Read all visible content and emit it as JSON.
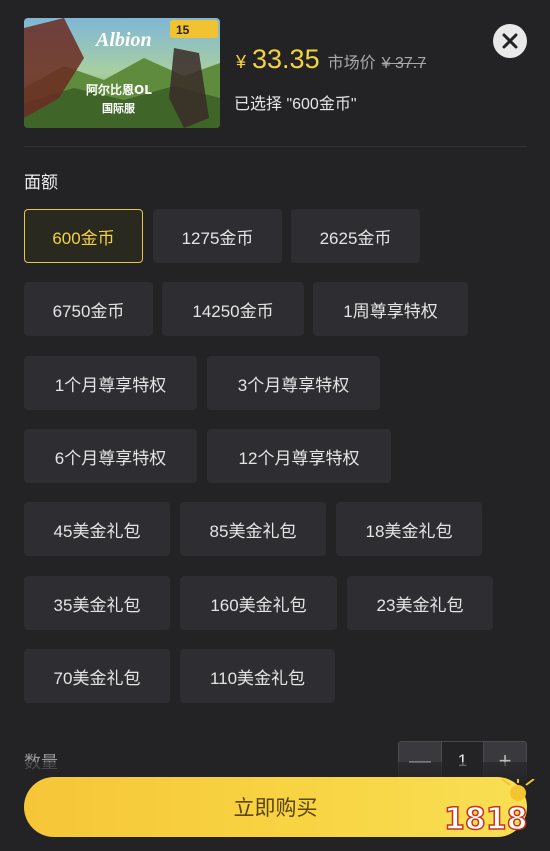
{
  "product": {
    "cover_title": "Albion",
    "cover_subtitle": "阿尔比恩OL",
    "cover_subtitle2": "国际服",
    "cover_badge": "15"
  },
  "price": {
    "currency": "¥",
    "value": "33.35",
    "market_label": "市场价",
    "market_price": "¥ 37.7"
  },
  "selected_text": "已选择 \"600金币\"",
  "denomination": {
    "title": "面额",
    "options": [
      "600金币",
      "1275金币",
      "2625金币",
      "6750金币",
      "14250金币",
      "1周尊享特权",
      "1个月尊享特权",
      "3个月尊享特权",
      "6个月尊享特权",
      "12个月尊享特权",
      "45美金礼包",
      "85美金礼包",
      "18美金礼包",
      "35美金礼包",
      "160美金礼包",
      "23美金礼包",
      "70美金礼包",
      "110美金礼包"
    ],
    "selected_index": 0
  },
  "quantity": {
    "label": "数量",
    "value": "1",
    "minus": "—",
    "plus": "+"
  },
  "buy_button": "立即购买",
  "watermark_text": "1818",
  "colors": {
    "accent": "#f5d33d",
    "panel": "#232326",
    "option_bg": "#2e2e32"
  }
}
